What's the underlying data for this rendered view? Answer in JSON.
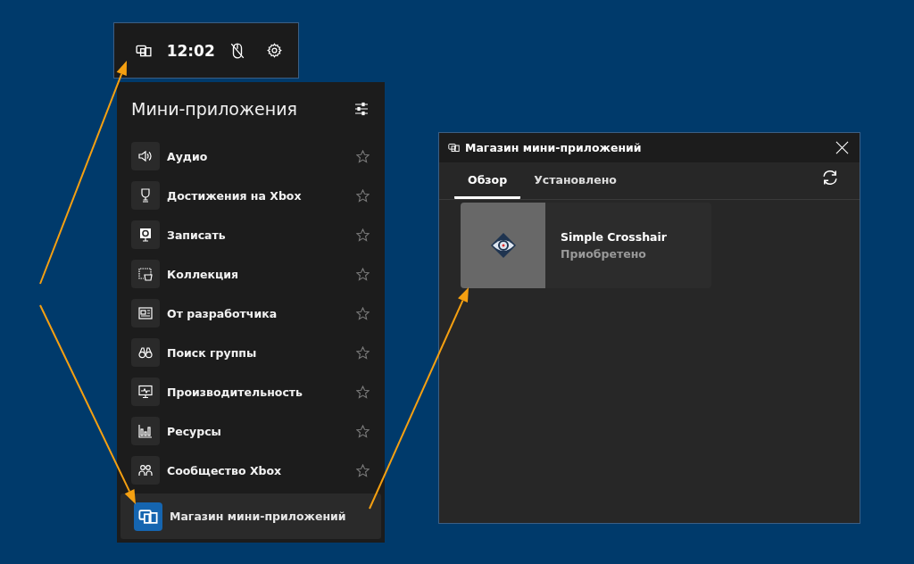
{
  "top_bar": {
    "time": "12:02"
  },
  "widgets_panel": {
    "title": "Мини-приложения",
    "widgets": [
      {
        "label": "Аудио",
        "favorite": false
      },
      {
        "label": "Достижения на Xbox",
        "favorite": false
      },
      {
        "label": "Записать",
        "favorite": false
      },
      {
        "label": "Коллекция",
        "favorite": false
      },
      {
        "label": "От разработчика",
        "favorite": false
      },
      {
        "label": "Поиск группы",
        "favorite": false
      },
      {
        "label": "Производительность",
        "favorite": false
      },
      {
        "label": "Ресурсы",
        "favorite": false
      },
      {
        "label": "Сообщество Xbox",
        "favorite": false
      }
    ],
    "store_link": {
      "label": "Магазин мини-приложений"
    }
  },
  "store_window": {
    "title": "Магазин мини-приложений",
    "tabs": [
      {
        "label": "Обзор",
        "selected": true
      },
      {
        "label": "Установлено",
        "selected": false
      }
    ],
    "items": [
      {
        "name": "Simple Crosshair",
        "status": "Приобретено"
      }
    ]
  }
}
